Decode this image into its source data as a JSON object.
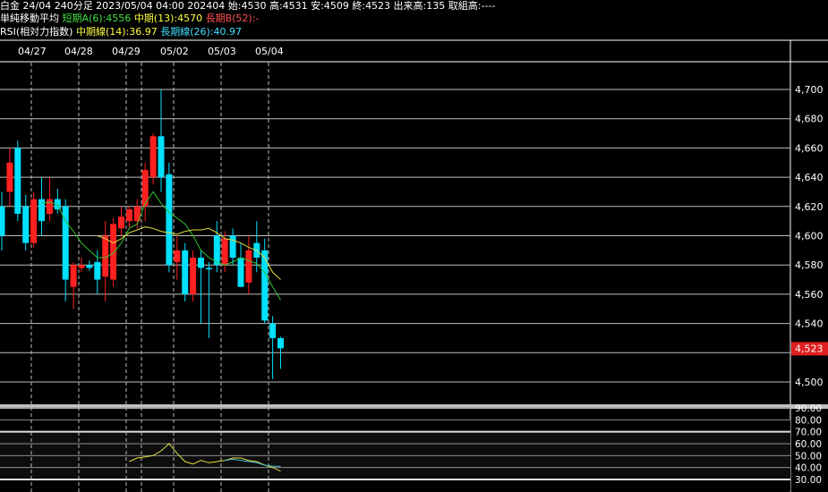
{
  "header": {
    "line1": "白金 24/04 240分足 2023/05/04 04:00 202404 始:4530 高:4531 安:4509 終:4523 出来高:135 取組高:----",
    "ma_title": "単純移動平均",
    "ma_short": "短期A(6):4556",
    "ma_mid": "中期(13):4570",
    "ma_long": "長期B(52):-",
    "rsi_title": "RSI(相対力指数)",
    "rsi_mid": "中期線(14):36.97",
    "rsi_long": "長期線(26):40.97"
  },
  "dates": [
    "04/27",
    "04/28",
    "04/29",
    "05/02",
    "05/03",
    "05/04"
  ],
  "price_axis": {
    "labels": [
      "4,700",
      "4,680",
      "4,660",
      "4,640",
      "4,620",
      "4,600",
      "4,580",
      "4,560",
      "4,540",
      "4,500"
    ],
    "current": "4,523"
  },
  "rsi_axis": {
    "labels": [
      "90.00",
      "80.00",
      "70.00",
      "60.00",
      "50.00",
      "40.00",
      "30.00"
    ]
  },
  "colors": {
    "up": "#ff2020",
    "down": "#00e0ff",
    "ma_short": "#30c030",
    "ma_mid": "#e0e040",
    "rsi": "#e0e040",
    "rsi_long": "#40c0d0",
    "price_badge": "#e02020"
  },
  "chart_data": {
    "type": "candlestick",
    "ylim": [
      4490,
      4710
    ],
    "candles": [
      {
        "o": 4620,
        "h": 4630,
        "l": 4590,
        "c": 4600
      },
      {
        "o": 4630,
        "h": 4660,
        "l": 4620,
        "c": 4650
      },
      {
        "o": 4660,
        "h": 4665,
        "l": 4610,
        "c": 4615
      },
      {
        "o": 4620,
        "h": 4628,
        "l": 4590,
        "c": 4595
      },
      {
        "o": 4595,
        "h": 4630,
        "l": 4592,
        "c": 4625
      },
      {
        "o": 4625,
        "h": 4640,
        "l": 4600,
        "c": 4610
      },
      {
        "o": 4615,
        "h": 4640,
        "l": 4610,
        "c": 4625
      },
      {
        "o": 4625,
        "h": 4632,
        "l": 4615,
        "c": 4618
      },
      {
        "o": 4620,
        "h": 4625,
        "l": 4555,
        "c": 4570
      },
      {
        "o": 4565,
        "h": 4582,
        "l": 4550,
        "c": 4580
      },
      {
        "o": 4578,
        "h": 4585,
        "l": 4575,
        "c": 4580
      },
      {
        "o": 4580,
        "h": 4583,
        "l": 4576,
        "c": 4578
      },
      {
        "o": 4582,
        "h": 4590,
        "l": 4560,
        "c": 4570
      },
      {
        "o": 4572,
        "h": 4610,
        "l": 4555,
        "c": 4600
      },
      {
        "o": 4570,
        "h": 4612,
        "l": 4565,
        "c": 4608
      },
      {
        "o": 4605,
        "h": 4620,
        "l": 4600,
        "c": 4613
      },
      {
        "o": 4610,
        "h": 4620,
        "l": 4605,
        "c": 4618
      },
      {
        "o": 4610,
        "h": 4625,
        "l": 4605,
        "c": 4620
      },
      {
        "o": 4620,
        "h": 4650,
        "l": 4610,
        "c": 4645
      },
      {
        "o": 4640,
        "h": 4670,
        "l": 4635,
        "c": 4668
      },
      {
        "o": 4668,
        "h": 4700,
        "l": 4630,
        "c": 4640
      },
      {
        "o": 4642,
        "h": 4650,
        "l": 4575,
        "c": 4580
      },
      {
        "o": 4582,
        "h": 4600,
        "l": 4570,
        "c": 4590
      },
      {
        "o": 4590,
        "h": 4595,
        "l": 4555,
        "c": 4560
      },
      {
        "o": 4560,
        "h": 4590,
        "l": 4555,
        "c": 4585
      },
      {
        "o": 4585,
        "h": 4590,
        "l": 4540,
        "c": 4578
      },
      {
        "o": 4578,
        "h": 4582,
        "l": 4530,
        "c": 4577
      },
      {
        "o": 4600,
        "h": 4610,
        "l": 4575,
        "c": 4580
      },
      {
        "o": 4580,
        "h": 4603,
        "l": 4575,
        "c": 4598
      },
      {
        "o": 4600,
        "h": 4605,
        "l": 4580,
        "c": 4585
      },
      {
        "o": 4585,
        "h": 4595,
        "l": 4565,
        "c": 4565
      },
      {
        "o": 4568,
        "h": 4600,
        "l": 4560,
        "c": 4590
      },
      {
        "o": 4595,
        "h": 4610,
        "l": 4575,
        "c": 4585
      },
      {
        "o": 4590,
        "h": 4598,
        "l": 4540,
        "c": 4542
      },
      {
        "o": 4540,
        "h": 4545,
        "l": 4502,
        "c": 4530
      },
      {
        "o": 4530,
        "h": 4531,
        "l": 4509,
        "c": 4523
      }
    ],
    "ma_short": [
      null,
      null,
      null,
      null,
      null,
      4622,
      4623,
      4621,
      4610,
      4603,
      4595,
      4590,
      4585,
      4585,
      4588,
      4595,
      4605,
      4608,
      4622,
      4630,
      4622,
      4616,
      4612,
      4608,
      4600,
      4590,
      4585,
      4582,
      4580,
      4582,
      4585,
      4583,
      4581,
      4575,
      4565,
      4556
    ],
    "ma_mid": [
      null,
      null,
      null,
      null,
      null,
      null,
      null,
      null,
      null,
      null,
      null,
      null,
      4600,
      4598,
      4595,
      4598,
      4602,
      4604,
      4606,
      4605,
      4603,
      4602,
      4601,
      4603,
      4604,
      4604,
      4605,
      4602,
      4598,
      4597,
      4595,
      4592,
      4590,
      4585,
      4575,
      4570
    ],
    "rsi": [
      null,
      null,
      null,
      null,
      null,
      null,
      null,
      null,
      null,
      null,
      null,
      null,
      null,
      null,
      null,
      null,
      45,
      48,
      49,
      50,
      54,
      60,
      52,
      45,
      43,
      46,
      44,
      45,
      46,
      48,
      48,
      46,
      45,
      42,
      40,
      37
    ],
    "rsi_long": [
      null,
      null,
      null,
      null,
      null,
      null,
      null,
      null,
      null,
      null,
      null,
      null,
      null,
      null,
      null,
      null,
      null,
      null,
      null,
      null,
      null,
      null,
      null,
      null,
      null,
      null,
      null,
      null,
      46,
      47,
      46,
      45,
      44,
      42,
      41,
      41
    ]
  }
}
